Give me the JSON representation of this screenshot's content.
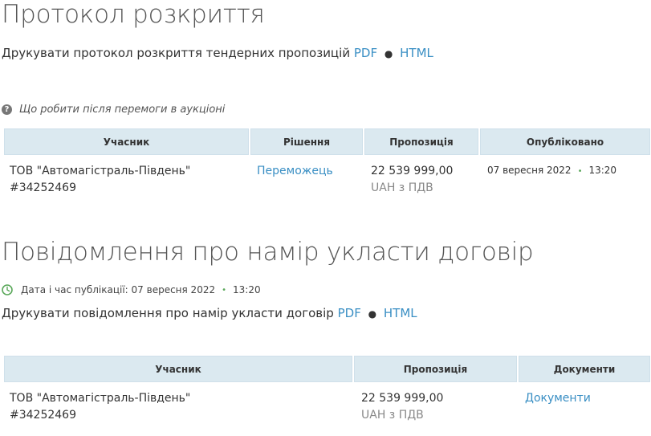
{
  "protocol": {
    "title": "Протокол розкриття",
    "print_text": "Друкувати протокол розкриття тендерних пропозицій",
    "pdf_link": "PDF",
    "html_link": "HTML",
    "help_text": "Що робити після перемоги в аукціоні",
    "table": {
      "headers": [
        "Учасник",
        "Рішення",
        "Пропозиція",
        "Опубліковано"
      ],
      "row": {
        "participant_name": "ТОВ \"Автомагістраль-Південь\"",
        "participant_id": "#34252469",
        "decision": "Переможець",
        "amount": "22 539 999,00",
        "currency": "UAH з ПДВ",
        "published_date": "07 вересня 2022",
        "published_time": "13:20"
      }
    }
  },
  "notice": {
    "title": "Повідомлення про намір укласти договір",
    "pub_label": "Дата і час публікації: 07 вересня 2022",
    "pub_time": "13:20",
    "print_text": "Друкувати повідомлення про намір укласти договір",
    "pdf_link": "PDF",
    "html_link": "HTML",
    "table": {
      "headers": [
        "Учасник",
        "Пропозиція",
        "Документи"
      ],
      "row": {
        "participant_name": "ТОВ \"Автомагістраль-Південь\"",
        "participant_id": "#34252469",
        "amount": "22 539 999,00",
        "currency": "UAH з ПДВ",
        "documents_link": "Документи"
      }
    }
  },
  "colors": {
    "link": "#3a8fc4",
    "table_header_bg": "#dbe9f0",
    "separator_green": "#5aa85a"
  }
}
